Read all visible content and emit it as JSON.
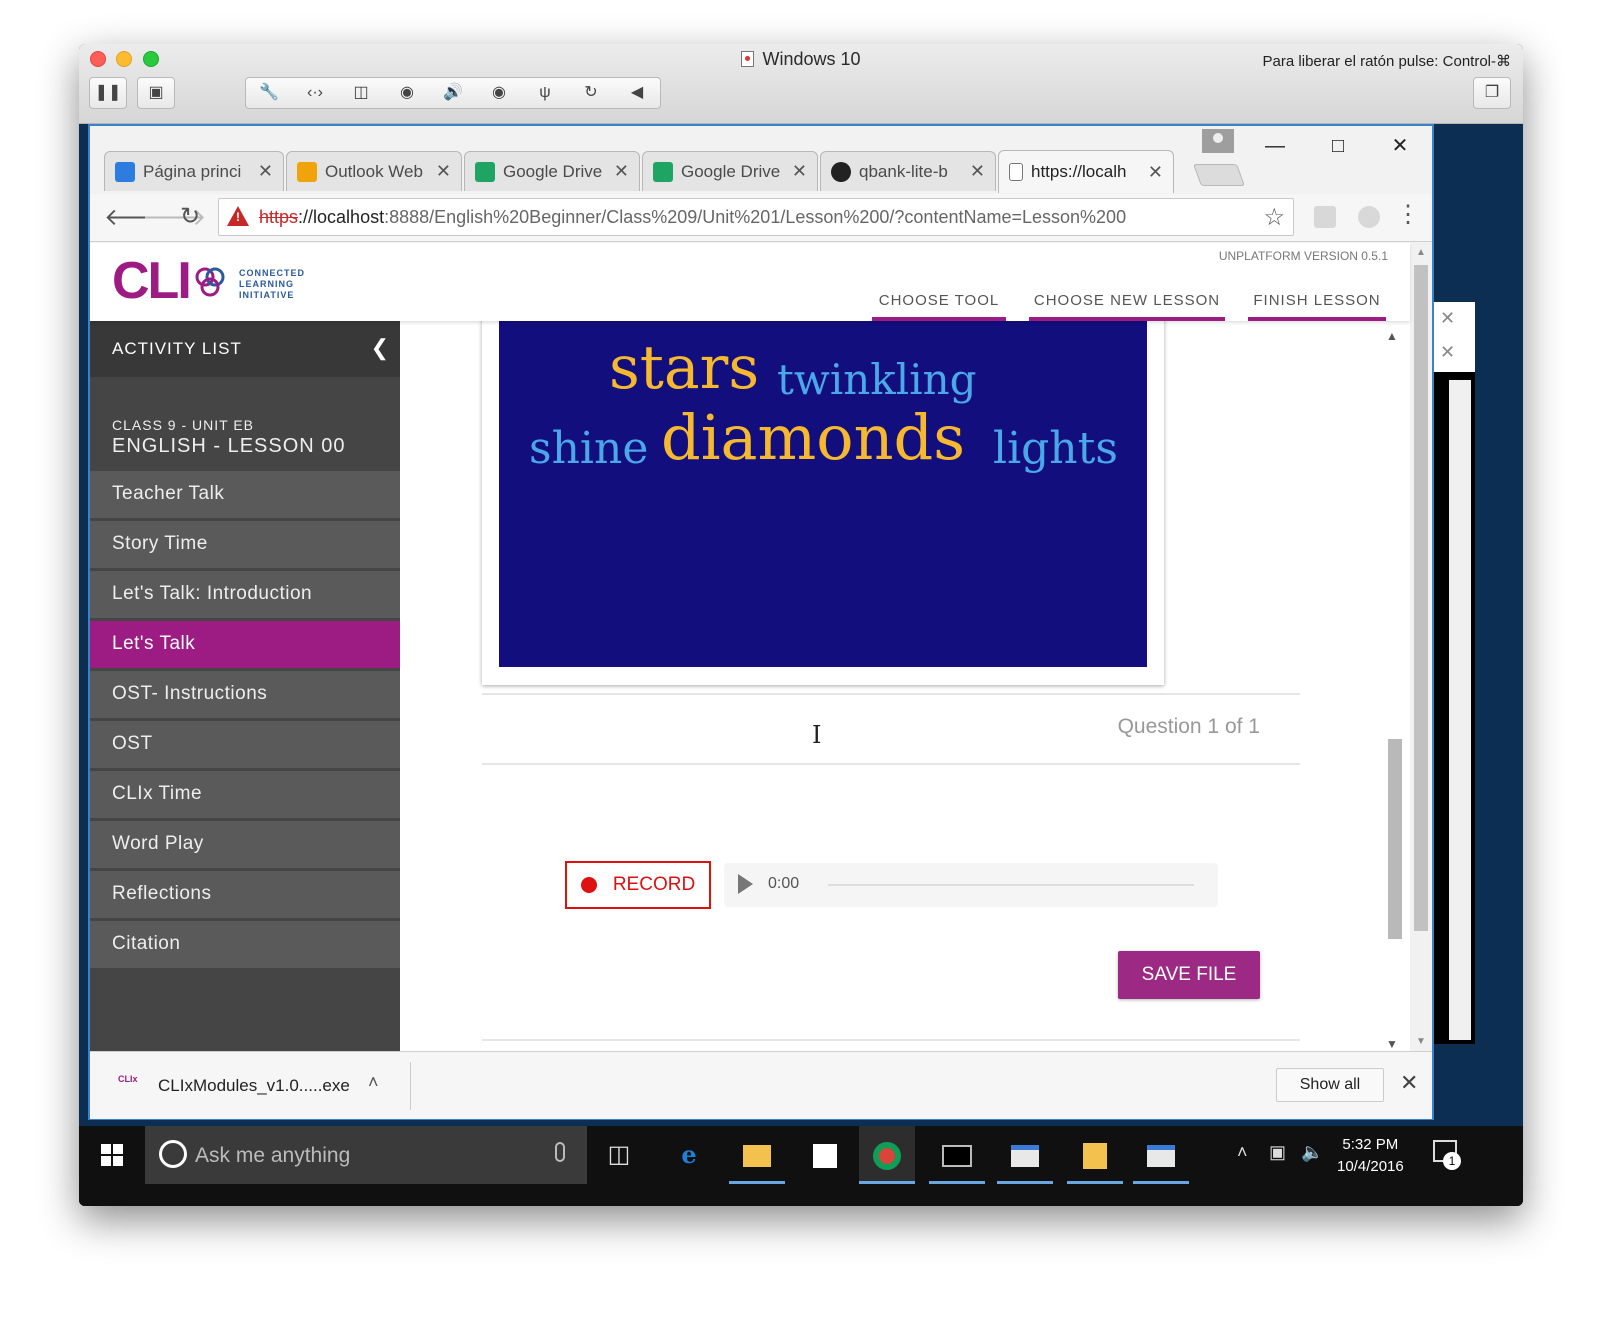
{
  "vm": {
    "title": "Windows 10",
    "hint": "Para liberar el ratón pulse: Control-⌘"
  },
  "browser": {
    "tabs": [
      {
        "title": "Página princi",
        "icon": "dropbox-icon",
        "color": "#2d7de0"
      },
      {
        "title": "Outlook Web",
        "icon": "outlook-icon",
        "color": "#f0a30a"
      },
      {
        "title": "Google Drive",
        "icon": "google-drive-icon",
        "color": "#1fa463"
      },
      {
        "title": "Google Drive",
        "icon": "google-drive-icon",
        "color": "#1fa463"
      },
      {
        "title": "qbank-lite-b",
        "icon": "github-icon",
        "color": "#222222"
      },
      {
        "title": "https://localh",
        "icon": "page-icon",
        "color": "#ffffff"
      }
    ],
    "url_scheme": "https",
    "url_rest": "://localhost",
    "url_path": ":8888/English%20Beginner/Class%209/Unit%201/Lesson%200/?contentName=Lesson%200"
  },
  "app": {
    "platform_version": "UNPLATFORM VERSION 0.5.1",
    "logo": {
      "text": "CLI",
      "tagline": [
        "CONNECTED",
        "LEARNING",
        "INITIATIVE"
      ]
    },
    "nav": {
      "choose_tool": "CHOOSE TOOL",
      "choose_new_lesson": "CHOOSE NEW LESSON",
      "finish_lesson": "FINISH LESSON"
    },
    "accent_color": "#9c1c84"
  },
  "sidebar": {
    "header": "ACTIVITY LIST",
    "class_label": "CLASS 9 - UNIT EB",
    "lesson_name": "ENGLISH - LESSON 00",
    "activities": [
      {
        "label": "Teacher Talk",
        "selected": false
      },
      {
        "label": "Story Time",
        "selected": false
      },
      {
        "label": "Let's Talk: Introduction",
        "selected": false
      },
      {
        "label": "Let's Talk",
        "selected": true
      },
      {
        "label": "OST- Instructions",
        "selected": false
      },
      {
        "label": "OST",
        "selected": false
      },
      {
        "label": "CLIx Time",
        "selected": false
      },
      {
        "label": "Word Play",
        "selected": false
      },
      {
        "label": "Reflections",
        "selected": false
      },
      {
        "label": "Citation",
        "selected": false
      }
    ]
  },
  "content": {
    "word_cloud": [
      {
        "text": "stars",
        "color": "#f5b82e"
      },
      {
        "text": "twinkling",
        "color": "#4aa8e8"
      },
      {
        "text": "shine",
        "color": "#4aa8e8"
      },
      {
        "text": "diamonds",
        "color": "#f5b82e"
      },
      {
        "text": "lights",
        "color": "#4aa8e8"
      }
    ],
    "question_count": "Question 1 of 1",
    "record_label": "RECORD",
    "audio_time": "0:00",
    "save_label": "SAVE FILE"
  },
  "download": {
    "icon_text": "CLIx",
    "filename": "CLIxModules_v1.0.....exe",
    "show_all": "Show all"
  },
  "taskbar": {
    "search_placeholder": "Ask me anything",
    "time": "5:32 PM",
    "date": "10/4/2016",
    "notifications": "1"
  }
}
